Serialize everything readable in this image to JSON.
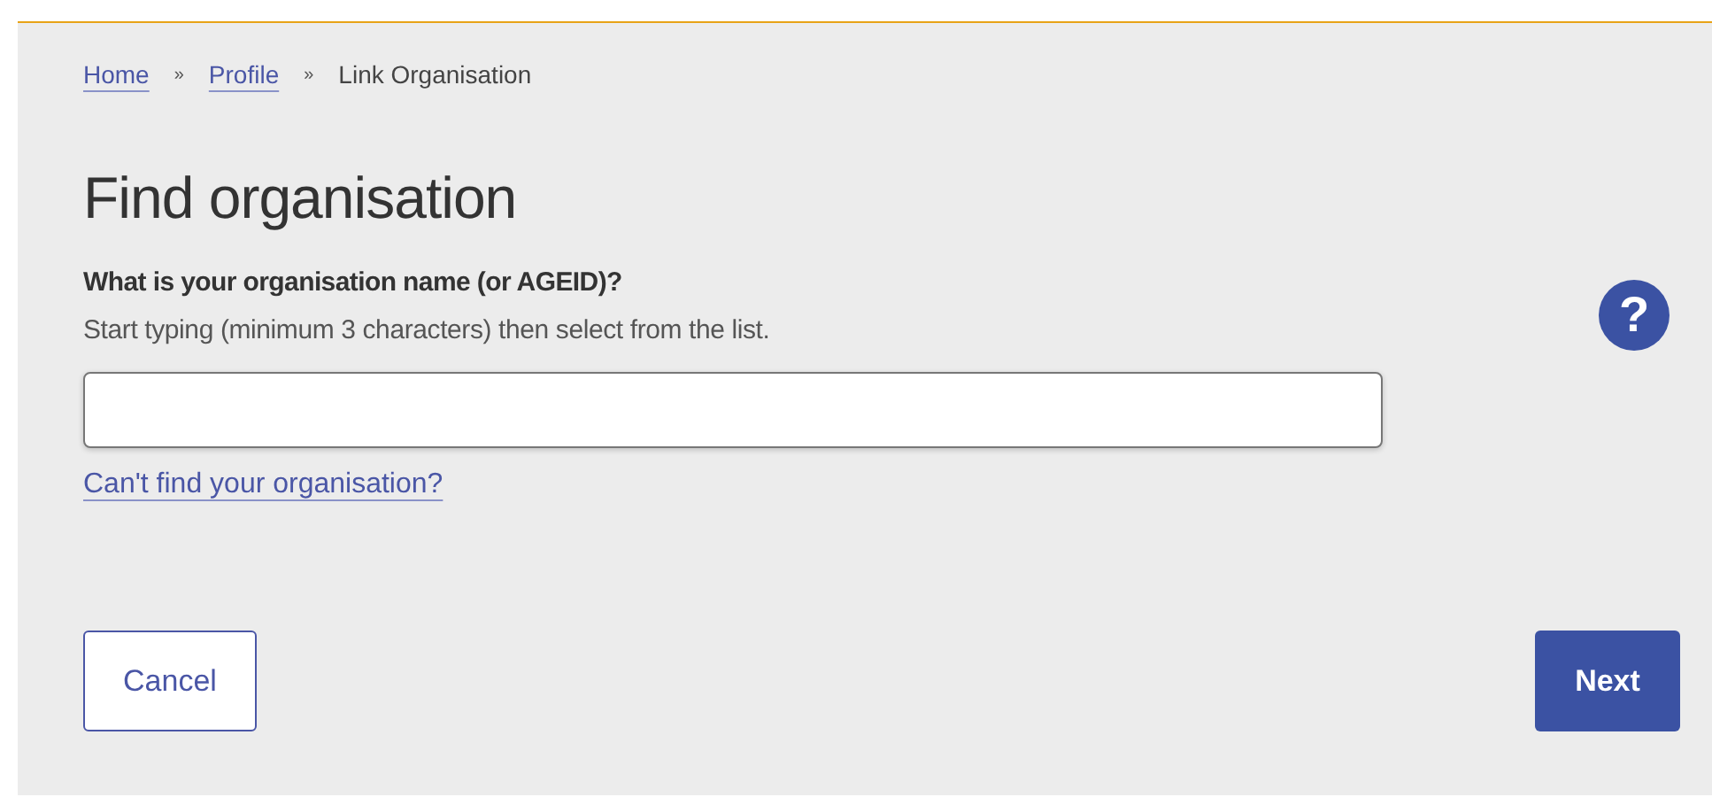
{
  "breadcrumbs": [
    {
      "label": "Home",
      "kind": "link"
    },
    {
      "label": "»",
      "kind": "separator"
    },
    {
      "label": "Profile",
      "kind": "link"
    },
    {
      "label": "»",
      "kind": "separator"
    },
    {
      "label": "Link Organisation",
      "kind": "current"
    }
  ],
  "heading": "Find organisation",
  "field": {
    "label": "What is your organisation name (or AGEID)?",
    "hint": "Start typing (minimum 3 characters) then select from the list.",
    "help": "?"
  },
  "help_link": "Can't find your organisation?",
  "buttons": [
    {
      "label": "Cancel",
      "kind": "secondary"
    },
    {
      "label": "Next",
      "kind": "primary"
    }
  ]
}
